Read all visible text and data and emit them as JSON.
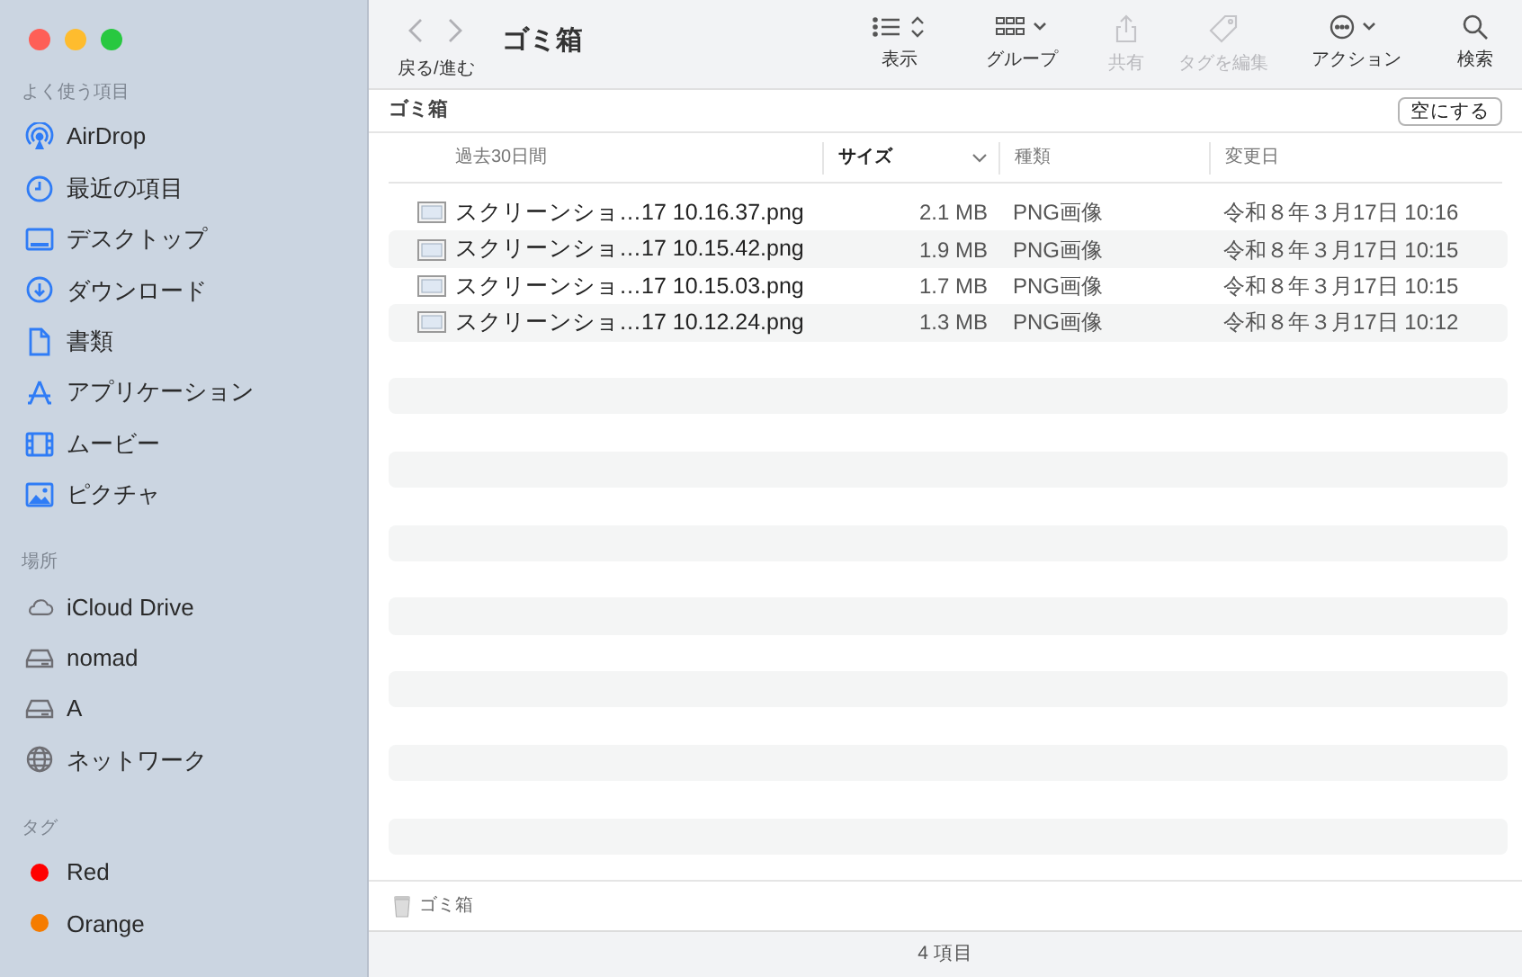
{
  "window": {
    "title": "ゴミ箱",
    "nav_label": "戻る/進む"
  },
  "toolbar": [
    {
      "kind": "view",
      "label": "表示",
      "disabled": false
    },
    {
      "kind": "group",
      "label": "グループ",
      "disabled": false
    },
    {
      "kind": "share",
      "label": "共有",
      "disabled": true
    },
    {
      "kind": "tag",
      "label": "タグを編集",
      "disabled": true
    },
    {
      "kind": "action",
      "label": "アクション",
      "disabled": false
    },
    {
      "kind": "search",
      "label": "検索",
      "disabled": false
    }
  ],
  "sidebar": {
    "sections": [
      {
        "heading": "よく使う項目",
        "items": [
          {
            "kind": "airdrop",
            "label": "AirDrop"
          },
          {
            "kind": "clock",
            "label": "最近の項目"
          },
          {
            "kind": "desktop",
            "label": "デスクトップ"
          },
          {
            "kind": "download",
            "label": "ダウンロード"
          },
          {
            "kind": "document",
            "label": "書類"
          },
          {
            "kind": "apps",
            "label": "アプリケーション"
          },
          {
            "kind": "film",
            "label": "ムービー"
          },
          {
            "kind": "picture",
            "label": "ピクチャ"
          }
        ]
      },
      {
        "heading": "場所",
        "items": [
          {
            "kind": "cloud",
            "label": "iCloud Drive"
          },
          {
            "kind": "disk",
            "label": "nomad"
          },
          {
            "kind": "disk",
            "label": "A"
          },
          {
            "kind": "globe",
            "label": "ネットワーク"
          }
        ]
      },
      {
        "heading": "タグ",
        "items": [
          {
            "kind": "tag",
            "label": "Red",
            "color": "#ff0000"
          },
          {
            "kind": "tag",
            "label": "Orange",
            "color": "#f57c00"
          }
        ]
      }
    ]
  },
  "path_bar": {
    "title": "ゴミ箱",
    "button": "空にする"
  },
  "columns": [
    {
      "label": "過去30日間",
      "sorted": false
    },
    {
      "label": "サイズ",
      "sorted": true
    },
    {
      "label": "種類",
      "sorted": false
    },
    {
      "label": "変更日",
      "sorted": false
    }
  ],
  "rows": [
    {
      "name": "スクリーンショ…17 10.16.37.png",
      "size": "2.1 MB",
      "type": "PNG画像",
      "date": "令和８年３月17日 10:16"
    },
    {
      "name": "スクリーンショ…17 10.15.42.png",
      "size": "1.9 MB",
      "type": "PNG画像",
      "date": "令和８年３月17日 10:15"
    },
    {
      "name": "スクリーンショ…17 10.15.03.png",
      "size": "1.7 MB",
      "type": "PNG画像",
      "date": "令和８年３月17日 10:15"
    },
    {
      "name": "スクリーンショ…17 10.12.24.png",
      "size": "1.3 MB",
      "type": "PNG画像",
      "date": "令和８年３月17日 10:12"
    }
  ],
  "footer": {
    "path": "ゴミ箱"
  },
  "status_bar": "4 項目"
}
